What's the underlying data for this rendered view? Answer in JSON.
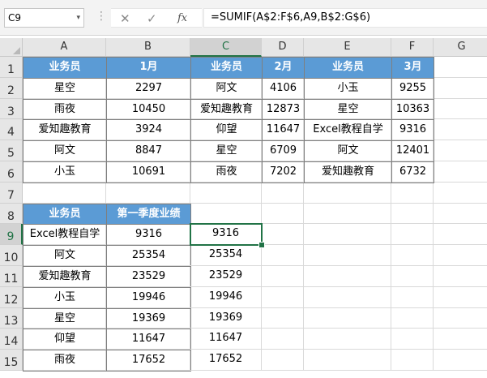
{
  "name_box": "C9",
  "formula": "=SUMIF(A$2:F$6,A9,B$2:G$6)",
  "icons": {
    "cancel": "✕",
    "enter": "✓",
    "fx": "fx",
    "dropdown": "▾",
    "separator": "⋮"
  },
  "columns": [
    "A",
    "B",
    "C",
    "D",
    "E",
    "F",
    "G"
  ],
  "rows": [
    "1",
    "2",
    "3",
    "4",
    "5",
    "6",
    "7",
    "8",
    "9",
    "10",
    "11",
    "12",
    "13",
    "14",
    "15"
  ],
  "active_cell": {
    "col": "C",
    "row": "9"
  },
  "table1": {
    "headers": [
      "业务员",
      "1月",
      "业务员",
      "2月",
      "业务员",
      "3月"
    ],
    "rows": [
      [
        "星空",
        "2297",
        "阿文",
        "4106",
        "小玉",
        "9255"
      ],
      [
        "雨夜",
        "10450",
        "爱知趣教育",
        "12873",
        "星空",
        "10363"
      ],
      [
        "爱知趣教育",
        "3924",
        "仰望",
        "11647",
        "Excel教程自学",
        "9316"
      ],
      [
        "阿文",
        "8847",
        "星空",
        "6709",
        "阿文",
        "12401"
      ],
      [
        "小玉",
        "10691",
        "雨夜",
        "7202",
        "爱知趣教育",
        "6732"
      ]
    ]
  },
  "table2": {
    "headers": [
      "业务员",
      "第一季度业绩"
    ],
    "rows": [
      [
        "Excel教程自学",
        "9316"
      ],
      [
        "阿文",
        "25354"
      ],
      [
        "爱知趣教育",
        "23529"
      ],
      [
        "小玉",
        "19946"
      ],
      [
        "星空",
        "19369"
      ],
      [
        "仰望",
        "11647"
      ],
      [
        "雨夜",
        "17652"
      ]
    ]
  },
  "results": [
    "9316",
    "25354",
    "23529",
    "19946",
    "19369",
    "11647",
    "17652"
  ],
  "colors": {
    "header_fill": "#5b9bd5",
    "selection": "#217346"
  }
}
